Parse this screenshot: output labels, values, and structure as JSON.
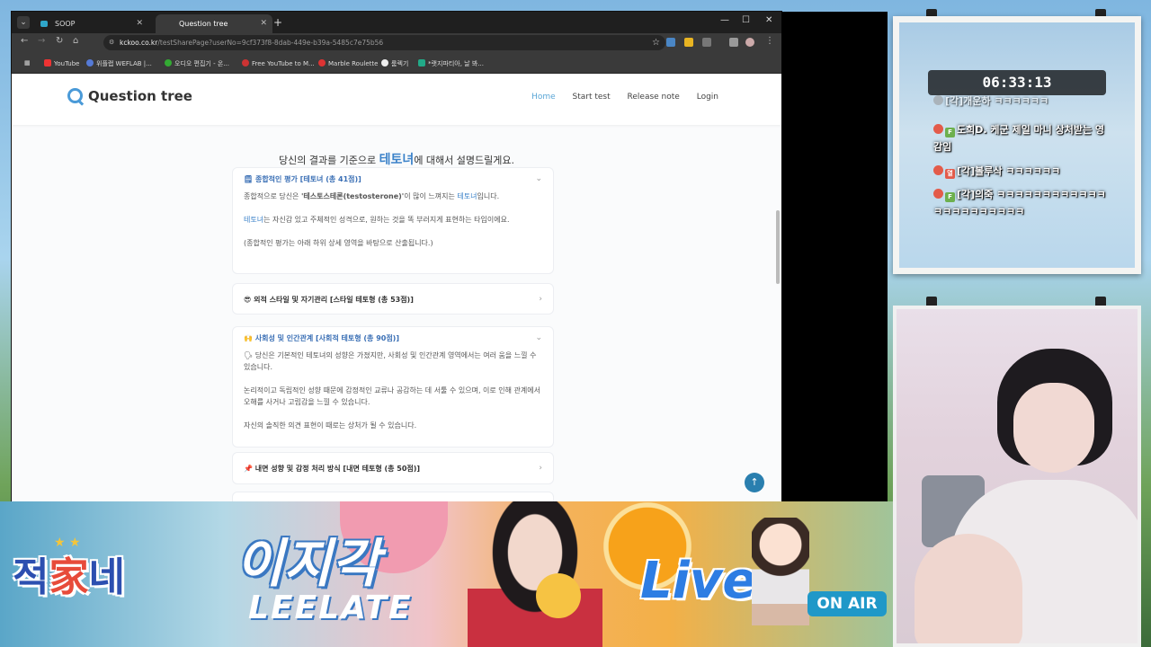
{
  "browser": {
    "tabs": [
      {
        "label": "SOOP",
        "active": false
      },
      {
        "label": "Question tree",
        "active": true
      }
    ],
    "url_site": "kckoo.co.kr",
    "url_rest": "/testSharePage?userNo=9cf373f8-8dab-449e-b39a-5485c7e75b56",
    "bookmarks": [
      "YouTube",
      "위플랩 WEFLAB |...",
      "오디오 편집기 - 온...",
      "Free YouTube to M...",
      "Marble Roulette",
      "룸렉기",
      "*랫지파티아, 날 봐..."
    ]
  },
  "site": {
    "logo": "Question tree",
    "nav": [
      "Home",
      "Start test",
      "Release note",
      "Login"
    ],
    "title_prefix": "당신의 결과를 기준으로 ",
    "title_em": "테토녀",
    "title_suffix": "에 대해서 설명드릴게요.",
    "cards": [
      {
        "header": "종합적인 평가 [테토녀 (총 41점)]",
        "icon": "🗒",
        "body": [
          {
            "a": "종합적으로 당신은 ",
            "b": "'테스토스테론(testosterone)'",
            "c": "이 많이 느껴지는 ",
            "d": "테토녀",
            "e": "입니다."
          },
          {
            "a": "",
            "b": "",
            "c": "",
            "d": "테토녀",
            "e": "는 자신감 있고 주체적인 성격으로, 원하는 것을 똑 부러지게 표현하는 타입이에요."
          },
          {
            "a": "(종합적인 평가는 아래 하위 상세 영역을 바탕으로 산출됩니다.)",
            "b": "",
            "c": "",
            "d": "",
            "e": ""
          }
        ]
      },
      {
        "header": "외적 스타일 및 자기관리 [스타일 테토형 (총 53점)]",
        "icon": "😎"
      },
      {
        "header": "사회성 및 인간관계 [사회적 테토형 (총 90점)]",
        "icon": "🙌",
        "body": [
          "🗣 당신은 기본적인 테토녀의 성향은 가졌지만, 사회성 및 인간관계 영역에서는 여러 움을 느낄 수 있습니다.",
          "논리적이고 독립적인 성향 때문에 감정적인 교류나 공감하는 데 서툴 수 있으며, 이로 인해 관계에서 오해를 사거나 고립감을 느낄 수 있습니다.",
          "자신의 솔직한 의견 표현이 때로는 상처가 될 수 있습니다."
        ]
      },
      {
        "header": "내면 성향 및 감정 처리 방식 [내면 테토형 (총 50점)]",
        "icon": "📌"
      }
    ]
  },
  "overlay": {
    "timer": "06:33:13",
    "chat": [
      {
        "user": "[각]개운하",
        "msg": "ㅋㅋㅋㅋㅋㅋ",
        "badge": "#9a9a9a"
      },
      {
        "user": "도희D.",
        "msg": "케군 제일 마니 상처받는 영감임",
        "badge": "#e35b4a"
      },
      {
        "user": "[각]볼루삭",
        "msg": "ㅋㅋㅋㅋㅋㅋ",
        "badge": "#e35b4a"
      },
      {
        "user": "[각]의죽",
        "msg": "ㅋㅋㅋㅋㅋㅋㅋㅋㅋㅋㅋㅋㅋㅋㅋㅋㅋㅋㅋㅋㅋㅋ",
        "badge": "#e35b4a"
      }
    ]
  },
  "banner": {
    "logo_left": "적",
    "logo_mid": "家",
    "logo_right": "네",
    "name_ko": "이지각",
    "name_en": "LEELATE",
    "live": "Live",
    "onair": "ON AIR"
  }
}
